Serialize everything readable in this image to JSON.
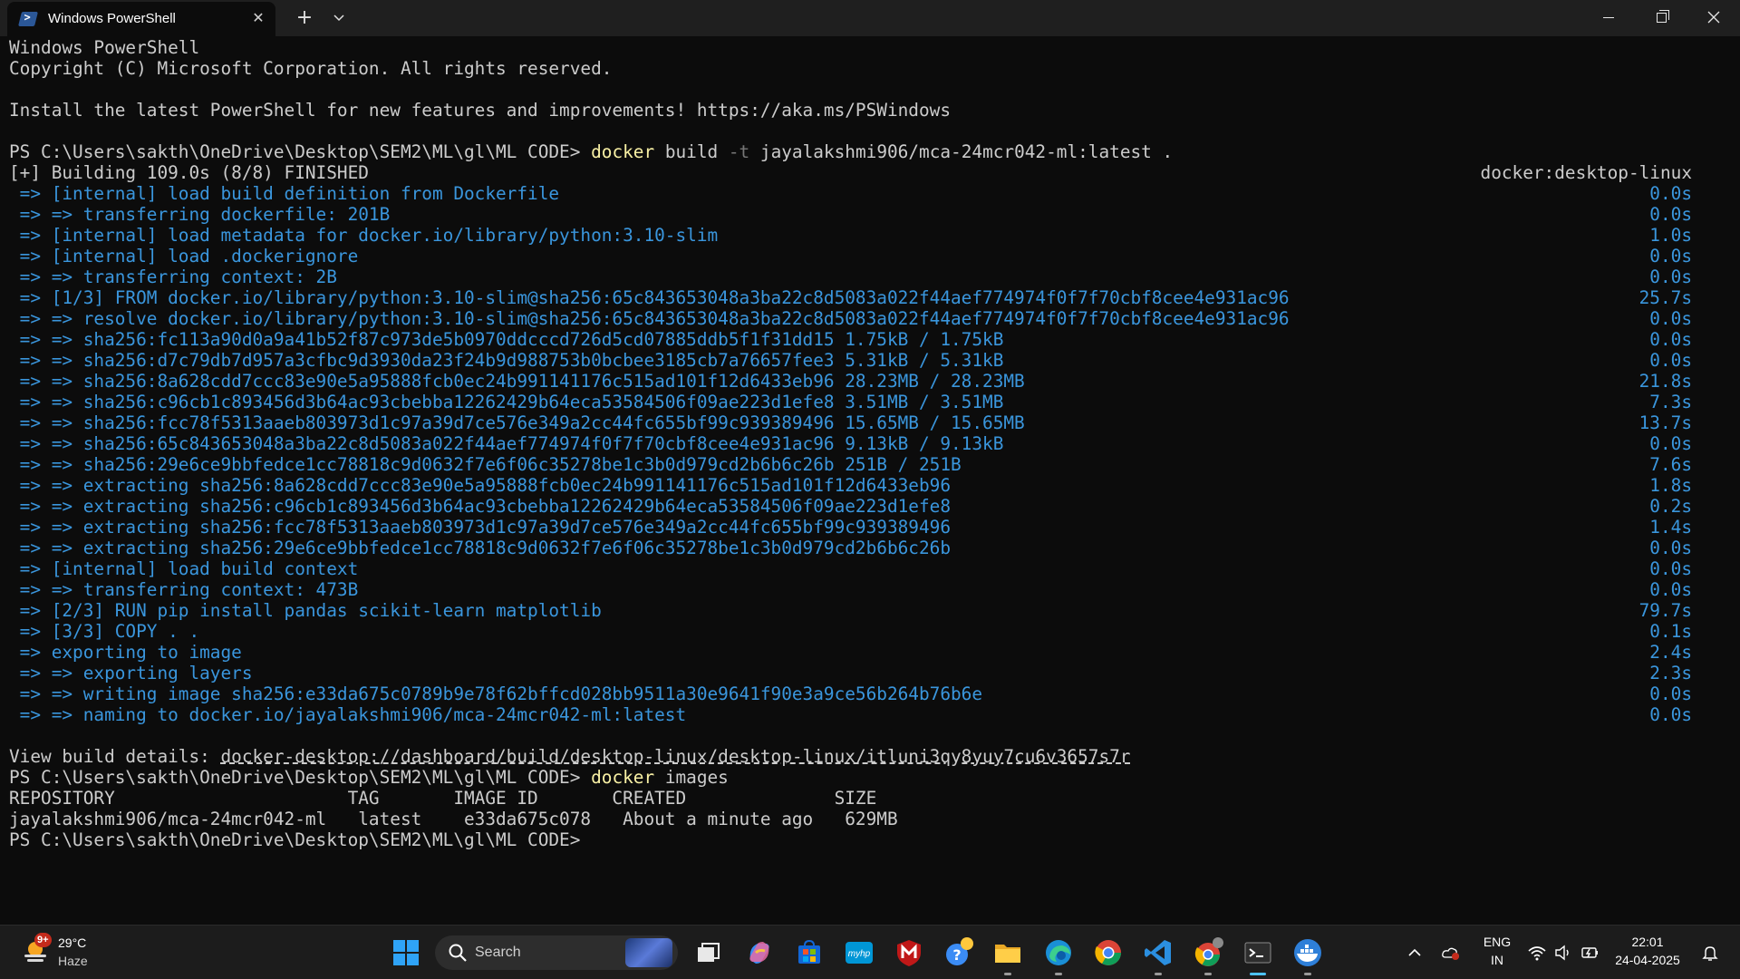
{
  "window": {
    "tab_title": "Windows PowerShell",
    "new_tab_glyph": "+",
    "dropdown_glyph": "⌄",
    "close_tab_glyph": "✕"
  },
  "terminal": {
    "lines": [
      {
        "text": "Windows PowerShell"
      },
      {
        "text": "Copyright (C) Microsoft Corporation. All rights reserved."
      },
      {
        "text": ""
      },
      {
        "text": "Install the latest PowerShell for new features and improvements! https://aka.ms/PSWindows"
      },
      {
        "text": ""
      },
      {
        "prompt": "PS C:\\Users\\sakth\\OneDrive\\Desktop\\SEM2\\ML\\gl\\ML CODE> ",
        "cmd": "docker",
        "flag_a": " build ",
        "flag": "-t",
        "args": " jayalakshmi906/mca-24mcr042-ml:latest ."
      },
      {
        "text": "[+] Building 109.0s (8/8) FINISHED",
        "right": "docker:desktop-linux"
      },
      {
        "text": " => [internal] load build definition from Dockerfile",
        "time": "0.0s"
      },
      {
        "text": " => => transferring dockerfile: 201B",
        "time": "0.0s"
      },
      {
        "text": " => [internal] load metadata for docker.io/library/python:3.10-slim",
        "time": "1.0s"
      },
      {
        "text": " => [internal] load .dockerignore",
        "time": "0.0s"
      },
      {
        "text": " => => transferring context: 2B",
        "time": "0.0s"
      },
      {
        "text": " => [1/3] FROM docker.io/library/python:3.10-slim@sha256:65c843653048a3ba22c8d5083a022f44aef774974f0f7f70cbf8cee4e931ac96",
        "time": "25.7s"
      },
      {
        "text": " => => resolve docker.io/library/python:3.10-slim@sha256:65c843653048a3ba22c8d5083a022f44aef774974f0f7f70cbf8cee4e931ac96",
        "time": "0.0s"
      },
      {
        "text": " => => sha256:fc113a90d0a9a41b52f87c973de5b0970ddcccd726d5cd07885ddb5f1f31dd15 1.75kB / 1.75kB",
        "time": "0.0s"
      },
      {
        "text": " => => sha256:d7c79db7d957a3cfbc9d3930da23f24b9d988753b0bcbee3185cb7a76657fee3 5.31kB / 5.31kB",
        "time": "0.0s"
      },
      {
        "text": " => => sha256:8a628cdd7ccc83e90e5a95888fcb0ec24b991141176c515ad101f12d6433eb96 28.23MB / 28.23MB",
        "time": "21.8s"
      },
      {
        "text": " => => sha256:c96cb1c893456d3b64ac93cbebba12262429b64eca53584506f09ae223d1efe8 3.51MB / 3.51MB",
        "time": "7.3s"
      },
      {
        "text": " => => sha256:fcc78f5313aaeb803973d1c97a39d7ce576e349a2cc44fc655bf99c939389496 15.65MB / 15.65MB",
        "time": "13.7s"
      },
      {
        "text": " => => sha256:65c843653048a3ba22c8d5083a022f44aef774974f0f7f70cbf8cee4e931ac96 9.13kB / 9.13kB",
        "time": "0.0s"
      },
      {
        "text": " => => sha256:29e6ce9bbfedce1cc78818c9d0632f7e6f06c35278be1c3b0d979cd2b6b6c26b 251B / 251B",
        "time": "7.6s"
      },
      {
        "text": " => => extracting sha256:8a628cdd7ccc83e90e5a95888fcb0ec24b991141176c515ad101f12d6433eb96",
        "time": "1.8s"
      },
      {
        "text": " => => extracting sha256:c96cb1c893456d3b64ac93cbebba12262429b64eca53584506f09ae223d1efe8",
        "time": "0.2s"
      },
      {
        "text": " => => extracting sha256:fcc78f5313aaeb803973d1c97a39d7ce576e349a2cc44fc655bf99c939389496",
        "time": "1.4s"
      },
      {
        "text": " => => extracting sha256:29e6ce9bbfedce1cc78818c9d0632f7e6f06c35278be1c3b0d979cd2b6b6c26b",
        "time": "0.0s"
      },
      {
        "text": " => [internal] load build context",
        "time": "0.0s"
      },
      {
        "text": " => => transferring context: 473B",
        "time": "0.0s"
      },
      {
        "text": " => [2/3] RUN pip install pandas scikit-learn matplotlib",
        "time": "79.7s"
      },
      {
        "text": " => [3/3] COPY . .",
        "time": "0.1s"
      },
      {
        "text": " => exporting to image",
        "time": "2.4s"
      },
      {
        "text": " => => exporting layers",
        "time": "2.3s"
      },
      {
        "text": " => => writing image sha256:e33da675c0789b9e78f62bffcd028bb9511a30e9641f90e3a9ce56b264b76b6e",
        "time": "0.0s"
      },
      {
        "text": " => => naming to docker.io/jayalakshmi906/mca-24mcr042-ml:latest",
        "time": "0.0s"
      },
      {
        "text": ""
      },
      {
        "text": "View build details: ",
        "link": "docker-desktop://dashboard/build/desktop-linux/desktop-linux/itluni3qy8yuy7cu6v3657s7r"
      },
      {
        "prompt": "PS C:\\Users\\sakth\\OneDrive\\Desktop\\SEM2\\ML\\gl\\ML CODE> ",
        "cmd": "docker",
        "args": " images"
      },
      {
        "text": "REPOSITORY                      TAG       IMAGE ID       CREATED              SIZE"
      },
      {
        "text": "jayalakshmi906/mca-24mcr042-ml   latest    e33da675c078   About a minute ago   629MB"
      },
      {
        "prompt": "PS C:\\Users\\sakth\\OneDrive\\Desktop\\SEM2\\ML\\gl\\ML CODE> "
      }
    ]
  },
  "taskbar": {
    "weather_badge": "9+",
    "weather_temp": "29°C",
    "weather_condition": "Haze",
    "search_label": "Search",
    "language_top": "ENG",
    "language_bottom": "IN",
    "time": "22:01",
    "date": "24-04-2025",
    "pinned_apps": [
      "start-icon",
      "search-icon",
      "task-view-icon",
      "copilot-icon",
      "microsoft-store-icon",
      "myhp-icon",
      "mcafee-icon",
      "help-icon",
      "file-explorer-icon",
      "edge-icon",
      "chrome-icon",
      "vscode-icon",
      "chrome-profile-icon",
      "terminal-icon",
      "docker-icon"
    ]
  },
  "colors": {
    "terminal_bg": "#0c0c0c",
    "terminal_text": "#cccccc",
    "docker_blue": "#3a96dd",
    "command_yellow": "#f9f1a5",
    "taskbar_bg": "#1c1c1c"
  }
}
